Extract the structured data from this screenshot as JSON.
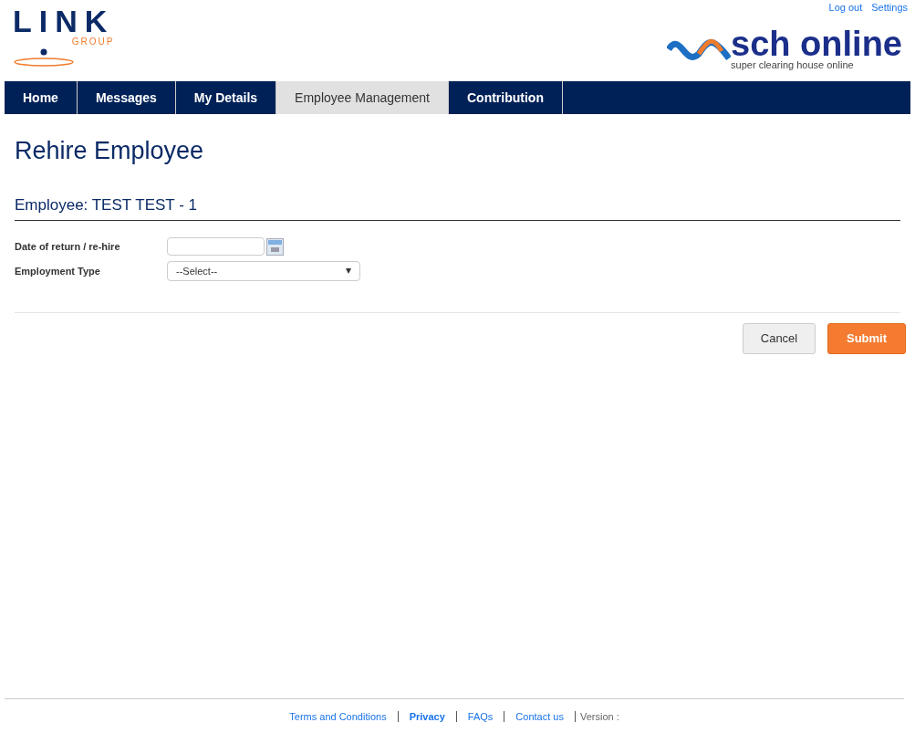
{
  "header": {
    "logo": {
      "word": "LINK",
      "sub": "GROUP"
    },
    "links": [
      "Log out",
      "Settings"
    ],
    "brand": {
      "name": "sch online",
      "tagline": "super clearing house online"
    }
  },
  "nav": [
    {
      "label": "Home",
      "selected": false
    },
    {
      "label": "Messages",
      "selected": false
    },
    {
      "label": "My Details",
      "selected": false
    },
    {
      "label": "Employee Management",
      "selected": true
    },
    {
      "label": "Contribution",
      "selected": false
    }
  ],
  "page_title": "Rehire Employee",
  "section_title": "Employee: TEST TEST - 1",
  "form": {
    "fields": [
      {
        "kind": "date",
        "label": "Date of return / re-hire"
      },
      {
        "kind": "select",
        "label": "Employment Type",
        "value": "--Select--"
      }
    ]
  },
  "buttons": [
    {
      "label": "Cancel",
      "kind": "secondary"
    },
    {
      "label": "Submit",
      "kind": "primary"
    }
  ],
  "footer": {
    "links": [
      "Terms and Conditions",
      "Privacy",
      "FAQs",
      "Contact us"
    ],
    "version": "Version :"
  }
}
